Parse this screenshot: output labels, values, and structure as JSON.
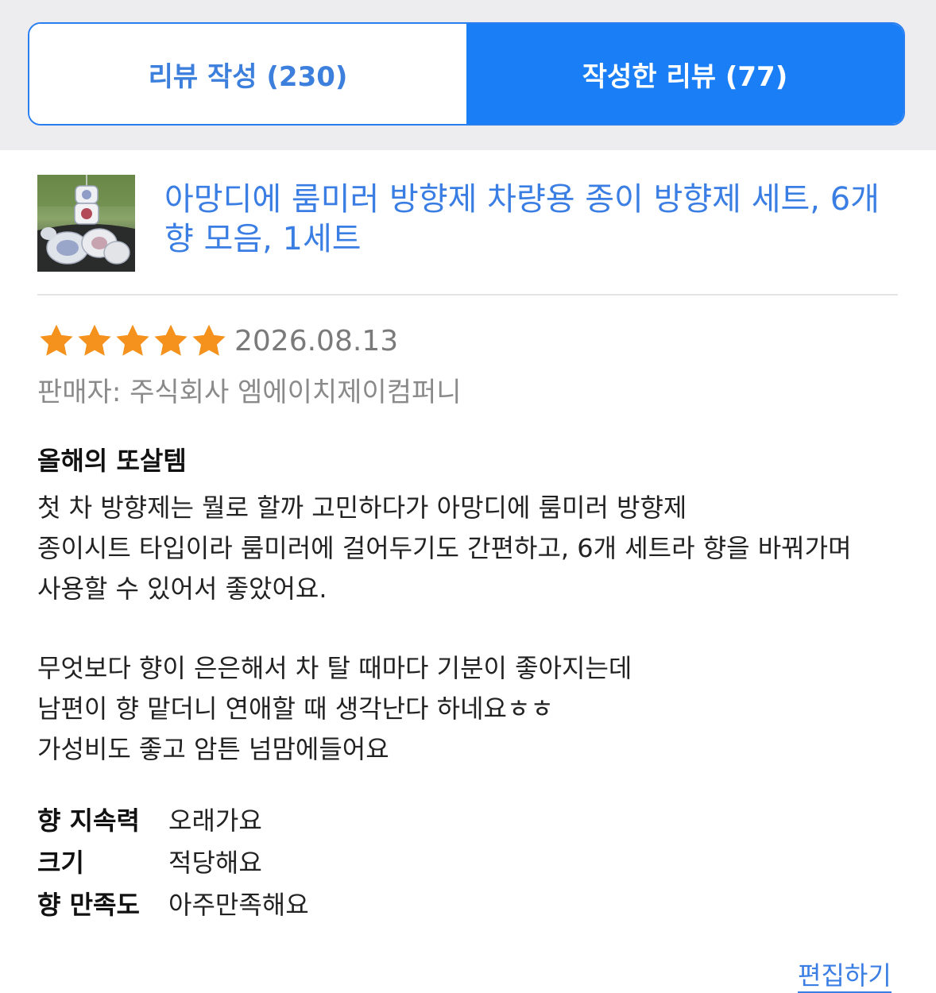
{
  "tabs": {
    "write_label": "리뷰 작성 (230)",
    "written_label": "작성한 리뷰 (77)",
    "active_color": "#1a7ff6"
  },
  "product": {
    "title": "아망디에 룸미러 방향제 차량용 종이 방향제 세트, 6개 향 모음, 1세트",
    "thumbnail_icon": "product-photo"
  },
  "review": {
    "rating": 5,
    "rating_max": 5,
    "star_color": "#f5921e",
    "date": "2026.08.13",
    "seller": "판매자: 주식회사 엠에이치제이컴퍼니",
    "headline": "올해의 또살템",
    "paragraphs": [
      [
        "첫 차 방향제는 뭘로 할까 고민하다가 아망디에 룸미러 방향제",
        "종이시트 타입이라 룸미러에 걸어두기도 간편하고, 6개 세트라 향을 바꿔가며",
        "사용할 수 있어서 좋았어요."
      ],
      [
        "무엇보다 향이 은은해서 차 탈 때마다 기분이 좋아지는데",
        "남편이 향 맡더니 연애할 때 생각난다 하네요ㅎㅎ",
        "가성비도 좋고 암튼 넘맘에들어요"
      ]
    ],
    "attributes": [
      {
        "label": "향 지속력",
        "value": "오래가요"
      },
      {
        "label": "크기",
        "value": "적당해요"
      },
      {
        "label": "향 만족도",
        "value": "아주만족해요"
      }
    ],
    "edit_label": "편집하기"
  }
}
